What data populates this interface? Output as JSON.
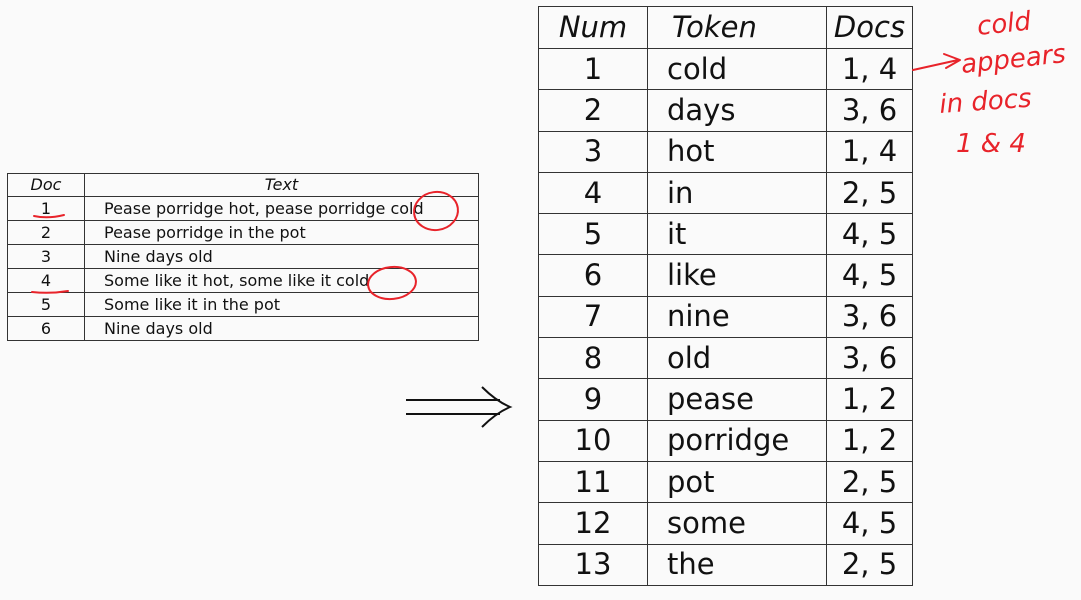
{
  "doc_table": {
    "headers": {
      "doc": "Doc",
      "text": "Text"
    },
    "rows": [
      {
        "doc": "1",
        "text": "Pease porridge hot, pease porridge cold"
      },
      {
        "doc": "2",
        "text": "Pease porridge in the pot"
      },
      {
        "doc": "3",
        "text": "Nine days old"
      },
      {
        "doc": "4",
        "text": "Some like it hot, some like it cold"
      },
      {
        "doc": "5",
        "text": "Some like it in the pot"
      },
      {
        "doc": "6",
        "text": "Nine days old"
      }
    ]
  },
  "index_table": {
    "headers": {
      "num": "Num",
      "token": "Token",
      "docs": "Docs"
    },
    "rows": [
      {
        "num": "1",
        "token": "cold",
        "docs": "1, 4"
      },
      {
        "num": "2",
        "token": "days",
        "docs": "3, 6"
      },
      {
        "num": "3",
        "token": "hot",
        "docs": "1, 4"
      },
      {
        "num": "4",
        "token": "in",
        "docs": "2, 5"
      },
      {
        "num": "5",
        "token": "it",
        "docs": "4, 5"
      },
      {
        "num": "6",
        "token": "like",
        "docs": "4, 5"
      },
      {
        "num": "7",
        "token": "nine",
        "docs": "3, 6"
      },
      {
        "num": "8",
        "token": "old",
        "docs": "3, 6"
      },
      {
        "num": "9",
        "token": "pease",
        "docs": "1, 2"
      },
      {
        "num": "10",
        "token": "porridge",
        "docs": "1, 2"
      },
      {
        "num": "11",
        "token": "pot",
        "docs": "2, 5"
      },
      {
        "num": "12",
        "token": "some",
        "docs": "4, 5"
      },
      {
        "num": "13",
        "token": "the",
        "docs": "2, 5"
      }
    ]
  },
  "annotation": {
    "lines": [
      "cold",
      "appears",
      "in docs",
      "1 & 4"
    ]
  },
  "colors": {
    "ink": "#e8232a",
    "text": "#111111",
    "rule": "#333333",
    "background": "#fafafa"
  },
  "icons": {
    "transform_arrow": "long-rightwards-double-arrow"
  }
}
